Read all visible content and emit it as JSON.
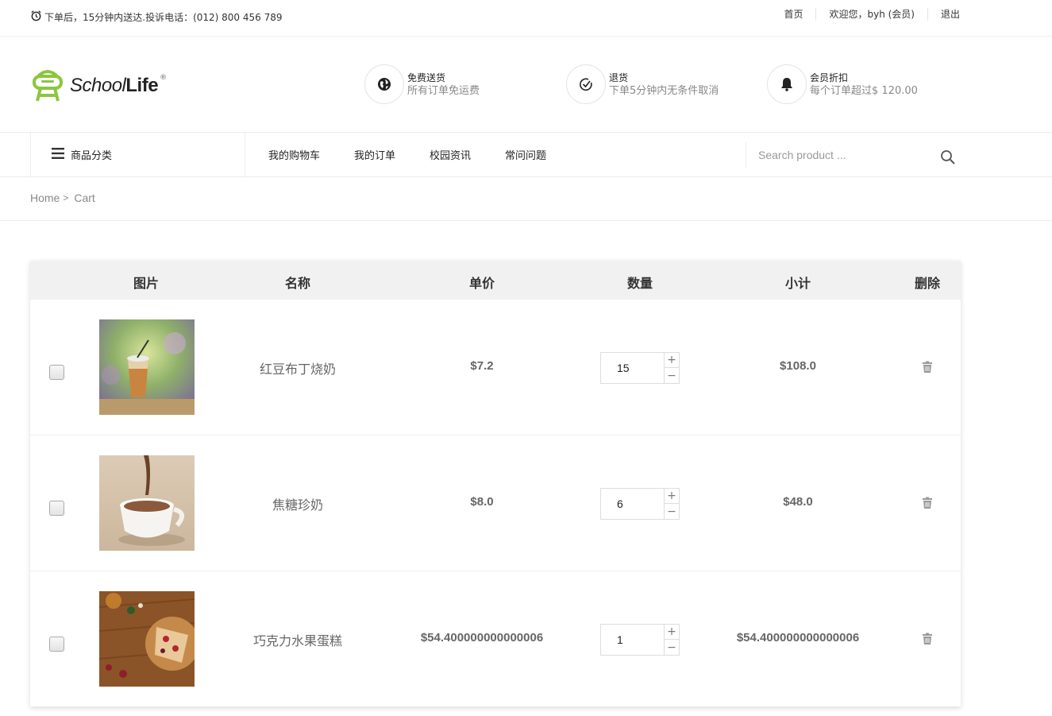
{
  "topbar": {
    "notice": "下单后，15分钟内送达.投诉电话：(012) 800 456 789",
    "home_link": "首页",
    "welcome": "欢迎您，byh (会员)",
    "logout": "退出"
  },
  "brand": {
    "logo_script": "School",
    "logo_bold": "Life",
    "logo_mark": "®"
  },
  "features": [
    {
      "icon": "globe-icon",
      "title": "免费送货",
      "desc": "所有订单免运费"
    },
    {
      "icon": "check-circle-icon",
      "title": "退货",
      "desc": "下单5分钟内无条件取消"
    },
    {
      "icon": "bell-icon",
      "title": "会员折扣",
      "desc": "每个订单超过$ 120.00"
    }
  ],
  "nav": {
    "category_label": "商品分类",
    "menu": [
      "我的购物车",
      "我的订单",
      "校园资讯",
      "常问问题"
    ],
    "search_placeholder": "Search product ..."
  },
  "breadcrumb": {
    "home": "Home",
    "separator": ">",
    "current": "Cart"
  },
  "cart": {
    "columns": [
      "图片",
      "名称",
      "单价",
      "数量",
      "小计",
      "删除"
    ],
    "items": [
      {
        "name": "红豆布丁烧奶",
        "price": "$7.2",
        "quantity": "15",
        "subtotal": "$108.0",
        "checked": false
      },
      {
        "name": "焦糖珍奶",
        "price": "$8.0",
        "quantity": "6",
        "subtotal": "$48.0",
        "checked": false
      },
      {
        "name": "巧克力水果蛋糕",
        "price": "$54.400000000000006",
        "quantity": "1",
        "subtotal": "$54.400000000000006",
        "checked": false
      }
    ],
    "qty_plus": "+",
    "qty_minus": "−"
  },
  "colors": {
    "logo_green": "#8cc63f",
    "header_bg": "#f1f1f1",
    "text_muted": "#888888"
  }
}
